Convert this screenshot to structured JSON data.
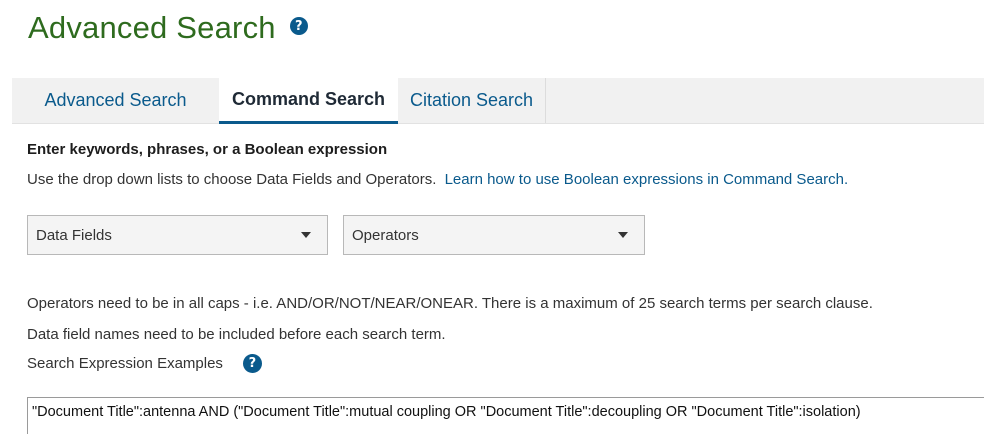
{
  "page": {
    "title": "Advanced Search"
  },
  "tabs": [
    {
      "label": "Advanced Search",
      "active": false
    },
    {
      "label": "Command Search",
      "active": true
    },
    {
      "label": "Citation Search",
      "active": false
    }
  ],
  "instructions": {
    "heading": "Enter keywords, phrases, or a Boolean expression",
    "text": "Use the drop down lists to choose Data Fields and Operators.",
    "link": "Learn how to use Boolean expressions in Command Search."
  },
  "dropdowns": {
    "data_fields": "Data Fields",
    "operators": "Operators"
  },
  "notes": {
    "operators_note": "Operators need to be in all caps - i.e. AND/OR/NOT/NEAR/ONEAR. There is a maximum of 25 search terms per search clause.",
    "fields_note": "Data field names need to be included before each search term.",
    "examples_label": "Search Expression Examples"
  },
  "search": {
    "expression": "\"Document Title\":antenna AND (\"Document Title\":mutual coupling OR \"Document Title\":decoupling OR \"Document Title\":isolation)"
  },
  "colors": {
    "title_green": "#2e6b1e",
    "link_blue": "#0a5a8c",
    "tab_bar_bg": "#f1f1f1"
  },
  "icons": {
    "help": "question-circle-icon",
    "dropdown": "caret-down-icon"
  }
}
